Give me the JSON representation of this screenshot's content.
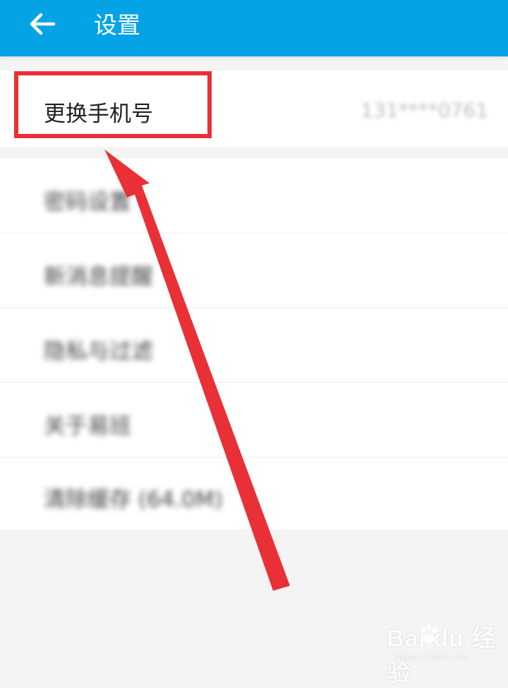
{
  "header": {
    "title": "设置",
    "back_icon": "arrow-left-icon",
    "background_color": "#03a3e6"
  },
  "settings": {
    "phone": {
      "label": "更换手机号",
      "value": "131****0761"
    },
    "items": [
      {
        "label": "密码设置"
      },
      {
        "label": "新消息提醒"
      },
      {
        "label": "隐私与过滤"
      },
      {
        "label": "关于易班"
      },
      {
        "label": "清除缓存 (64.0M)"
      }
    ]
  },
  "annotation": {
    "highlight_color": "#ea3037",
    "arrow_color": "#ea3037"
  },
  "watermark": {
    "logo_text": "Bai du 经验",
    "url": "jingyan.baidu.com"
  }
}
